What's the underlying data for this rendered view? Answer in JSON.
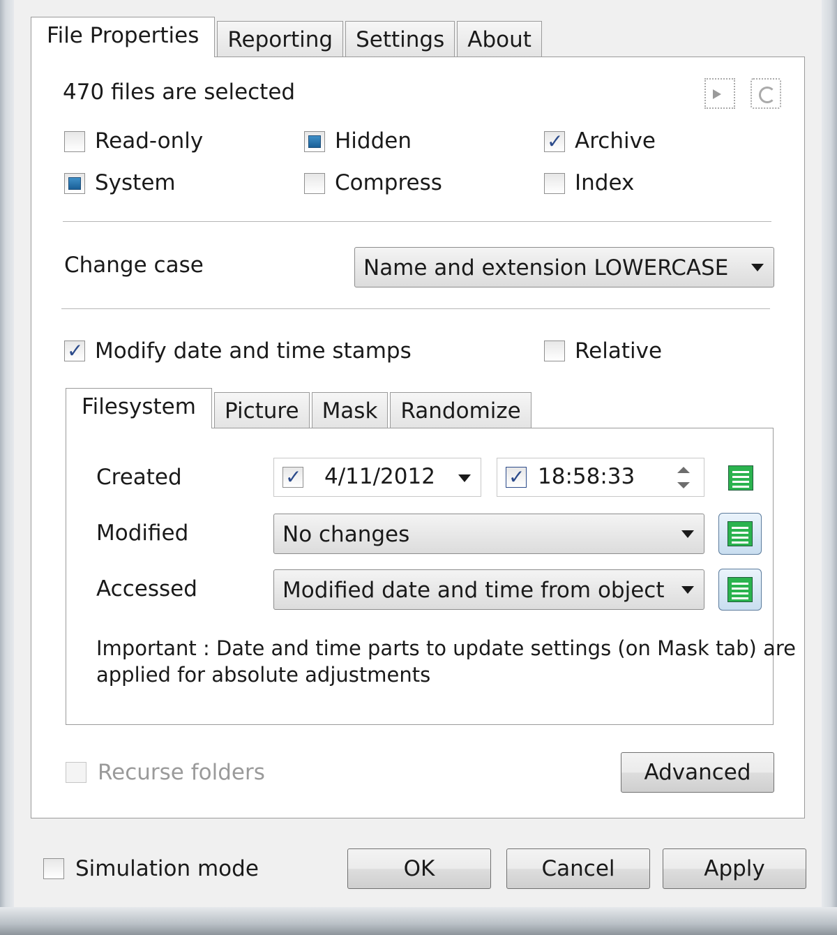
{
  "tabs": [
    "File Properties",
    "Reporting",
    "Settings",
    "About"
  ],
  "selection_text": "470 files are selected",
  "attributes": [
    {
      "label": "Read-only",
      "state": "unchecked"
    },
    {
      "label": "Hidden",
      "state": "indeterminate"
    },
    {
      "label": "Archive",
      "state": "checked"
    },
    {
      "label": "System",
      "state": "indeterminate"
    },
    {
      "label": "Compress",
      "state": "unchecked"
    },
    {
      "label": "Index",
      "state": "unchecked"
    }
  ],
  "change_case": {
    "label": "Change case",
    "value": "Name and extension LOWERCASE"
  },
  "modify_dates": {
    "label": "Modify date and time stamps",
    "checked": true
  },
  "relative": {
    "label": "Relative",
    "checked": false
  },
  "subtabs": [
    "Filesystem",
    "Picture",
    "Mask",
    "Randomize"
  ],
  "created": {
    "label": "Created",
    "date": "4/11/2012",
    "time": "18:58:33"
  },
  "modified": {
    "label": "Modified",
    "value": "No changes"
  },
  "accessed": {
    "label": "Accessed",
    "value": "Modified date and time from object"
  },
  "note_line1": "Important : Date and time parts to update settings (on Mask tab) are",
  "note_line2": "applied for absolute adjustments",
  "recurse": {
    "label": "Recurse folders"
  },
  "advanced_label": "Advanced",
  "simulation": {
    "label": "Simulation mode"
  },
  "buttons": {
    "ok": "OK",
    "cancel": "Cancel",
    "apply": "Apply"
  },
  "icons": {
    "toolbar": [
      "import-icon",
      "reset-icon"
    ],
    "list": "list-icon"
  },
  "colors": {
    "indeterminate": "#2a75b0",
    "list_icon": "#2bb34f"
  }
}
